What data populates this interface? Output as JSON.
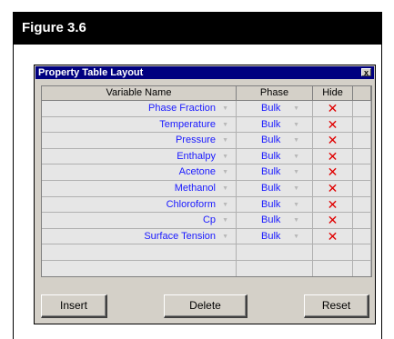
{
  "figure": {
    "title": "Figure 3.6"
  },
  "dialog": {
    "title": "Property Table Layout",
    "close_label": "x",
    "columns": [
      "Variable Name",
      "Phase",
      "Hide"
    ],
    "rows": [
      {
        "name": "Phase Fraction",
        "phase": "Bulk",
        "hide": "✕"
      },
      {
        "name": "Temperature",
        "phase": "Bulk",
        "hide": "✕"
      },
      {
        "name": "Pressure",
        "phase": "Bulk",
        "hide": "✕"
      },
      {
        "name": "Enthalpy",
        "phase": "Bulk",
        "hide": "✕"
      },
      {
        "name": "Acetone",
        "phase": "Bulk",
        "hide": "✕"
      },
      {
        "name": "Methanol",
        "phase": "Bulk",
        "hide": "✕"
      },
      {
        "name": "Chloroform",
        "phase": "Bulk",
        "hide": "✕"
      },
      {
        "name": "Cp",
        "phase": "Bulk",
        "hide": "✕"
      },
      {
        "name": "Surface Tension",
        "phase": "Bulk",
        "hide": "✕"
      }
    ],
    "buttons": {
      "insert": "Insert",
      "delete": "Delete",
      "reset": "Reset"
    }
  },
  "colors": {
    "titlebar": "#000080",
    "text_value": "#1a1aff",
    "hide_x": "#e00000",
    "dialog_bg": "#d4d0c8"
  }
}
